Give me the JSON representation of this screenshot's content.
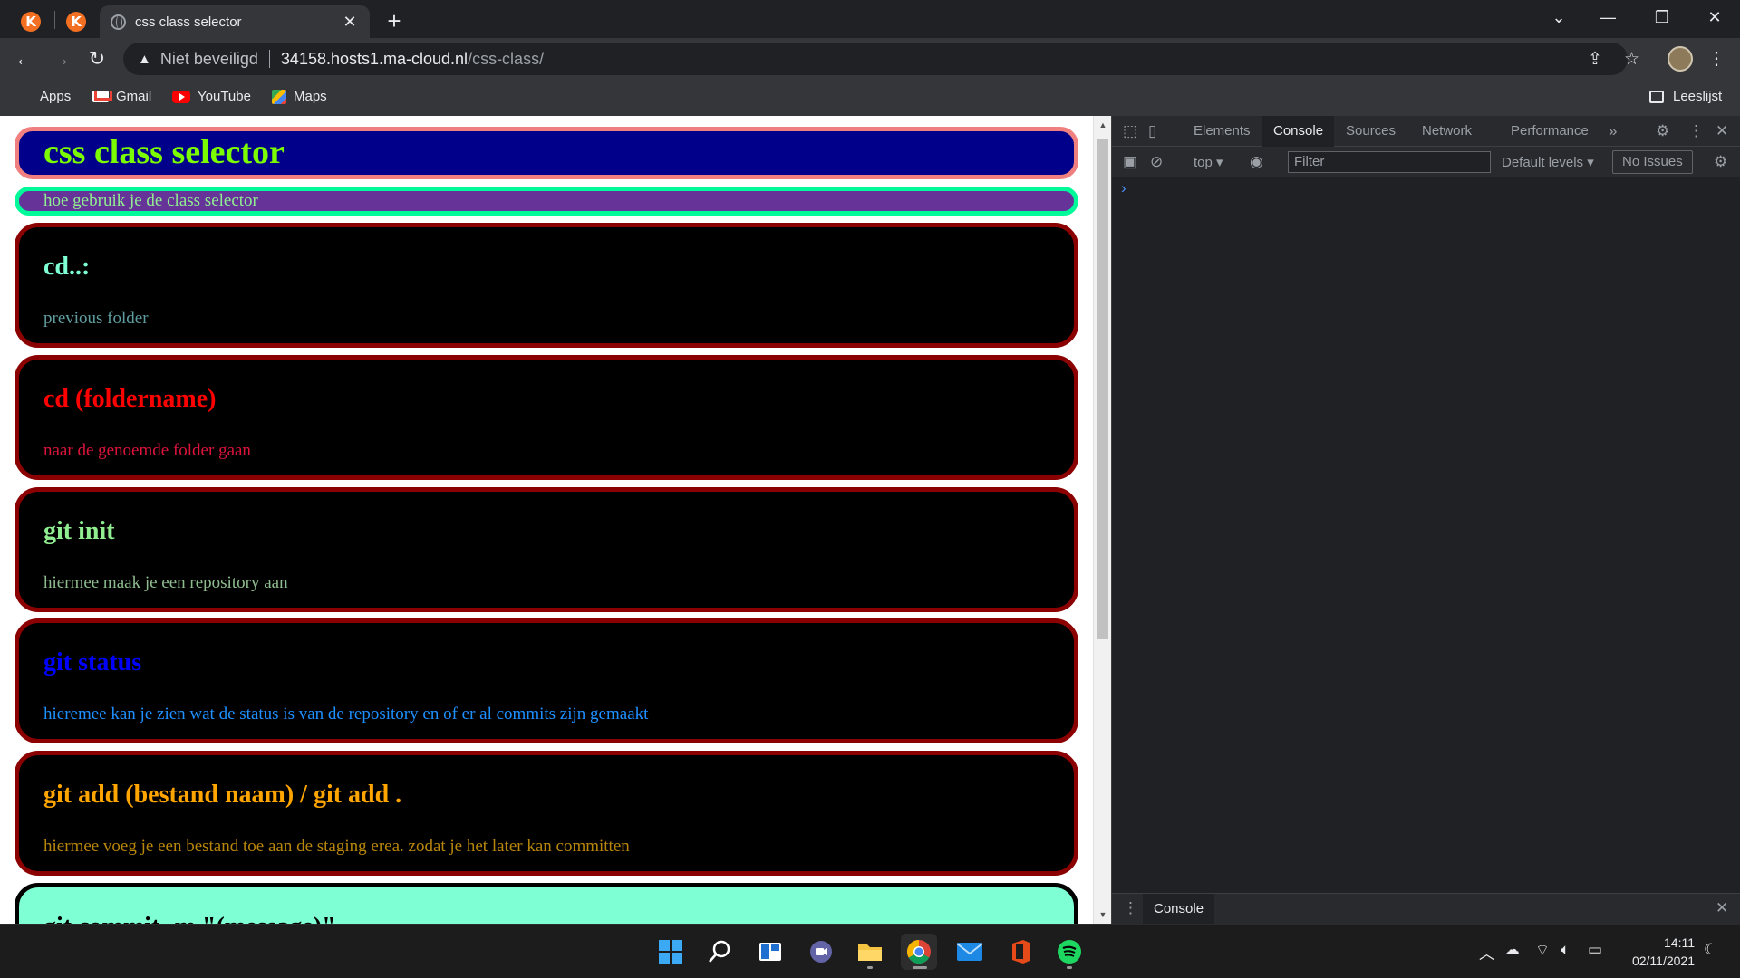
{
  "browser": {
    "tab_title": "css class selector",
    "url_security": "Niet beveiligd",
    "url_host": "34158.hosts1.ma-cloud.nl",
    "url_path": "/css-class/",
    "bookmarks": [
      "Apps",
      "Gmail",
      "YouTube",
      "Maps"
    ],
    "reading_list": "Leeslijst"
  },
  "page": {
    "title": "css class selector",
    "subtitle": "hoe gebruik je de class selector",
    "cards": [
      {
        "title": "cd..:",
        "desc": "previous folder",
        "title_color": "#7fffd4",
        "desc_color": "#5f9ea0"
      },
      {
        "title": "cd (foldername)",
        "desc": "naar de genoemde folder gaan",
        "title_color": "#ff0000",
        "desc_color": "#dc143c"
      },
      {
        "title": "git init",
        "desc": "hiermee maak je een repository aan",
        "title_color": "#90ee90",
        "desc_color": "#8fbc8f"
      },
      {
        "title": "git status",
        "desc": "hieremee kan je zien wat de status is van de repository en of er al commits zijn gemaakt",
        "title_color": "#0000ff",
        "desc_color": "#1e90ff"
      },
      {
        "title": "git add (bestand naam) / git add .",
        "desc": "hiermee voeg je een bestand toe aan de staging erea. zodat je het later kan committen",
        "title_color": "#ffa500",
        "desc_color": "#b8860b"
      },
      {
        "title": "git commit -m \"(message)\"",
        "desc": "",
        "title_color": "#000000",
        "desc_color": "#000000"
      }
    ]
  },
  "devtools": {
    "tabs": [
      "Elements",
      "Console",
      "Sources",
      "Network",
      "Performance"
    ],
    "active_tab": "Console",
    "context": "top",
    "filter_placeholder": "Filter",
    "levels": "Default levels",
    "issues": "No Issues",
    "drawer_tab": "Console"
  },
  "taskbar": {
    "time": "14:11",
    "date": "02/11/2021"
  },
  "colors": {
    "title_bg": "#00008b",
    "title_border": "#f08080",
    "title_text": "#7cfc00",
    "sub_bg": "#663399",
    "sub_border": "#00fa9a",
    "card_border": "#8b0000"
  }
}
